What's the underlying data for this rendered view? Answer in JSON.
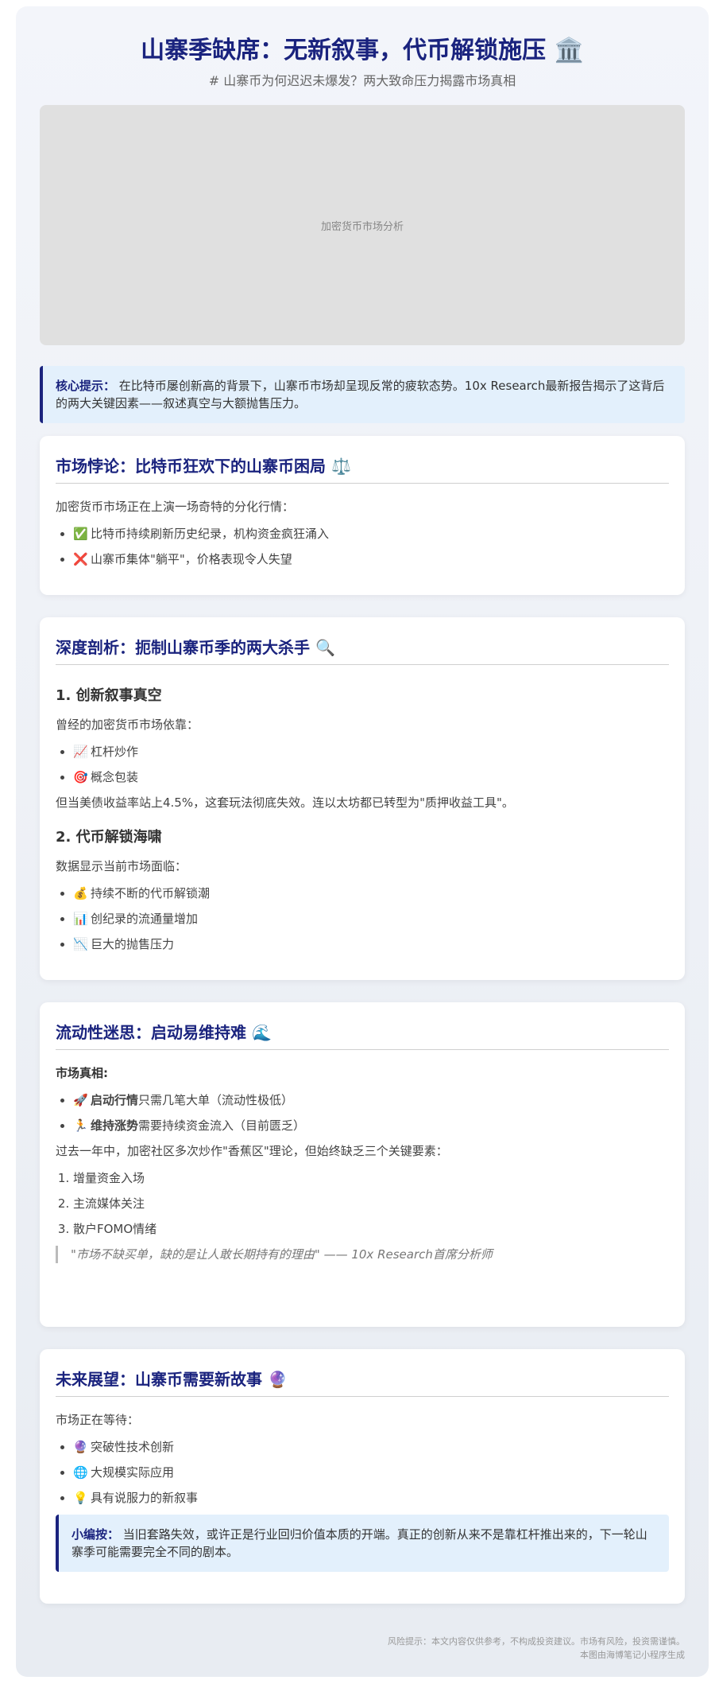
{
  "header": {
    "title": "山寨季缺席：无新叙事，代币解锁施压 🏛️",
    "subtitle": "# 山寨币为何迟迟未爆发？两大致命压力揭露市场真相"
  },
  "hero": {
    "caption": "加密货币市场分析"
  },
  "key_tip": {
    "label": "核心提示：",
    "text": "在比特币屡创新高的背景下，山寨币市场却呈现反常的疲软态势。10x Research最新报告揭示了这背后的两大关键因素——叙述真空与大额抛售压力。"
  },
  "section1": {
    "title": "市场悖论：比特币狂欢下的山寨币困局 ⚖️",
    "intro": "加密货币市场正在上演一场奇特的分化行情：",
    "items": [
      {
        "icon": "✅",
        "text": "比特币持续刷新历史纪录，机构资金疯狂涌入"
      },
      {
        "icon": "❌",
        "text": "山寨币集体\"躺平\"，价格表现令人失望"
      }
    ]
  },
  "section2": {
    "title": "深度剖析：扼制山寨币季的两大杀手 🔍",
    "sub1": {
      "heading": "1. 创新叙事真空",
      "intro": "曾经的加密货币市场依靠：",
      "items": [
        {
          "icon": "📈",
          "text": "杠杆炒作"
        },
        {
          "icon": "🎯",
          "text": "概念包装"
        }
      ],
      "outro": "但当美债收益率站上4.5%，这套玩法彻底失效。连以太坊都已转型为\"质押收益工具\"。"
    },
    "sub2": {
      "heading": "2. 代币解锁海啸",
      "intro": "数据显示当前市场面临：",
      "items": [
        {
          "icon": "💰",
          "text": "持续不断的代币解锁潮"
        },
        {
          "icon": "📊",
          "text": "创纪录的流通量增加"
        },
        {
          "icon": "📉",
          "text": "巨大的抛售压力"
        }
      ]
    }
  },
  "section3": {
    "title": "流动性迷思：启动易维持难 🌊",
    "truth_label": "市场真相:",
    "items": [
      {
        "icon": "🚀",
        "bold": "启动行情",
        "text": "只需几笔大单（流动性极低）"
      },
      {
        "icon": "🏃",
        "bold": "维持涨势",
        "text": "需要持续资金流入（目前匮乏）"
      }
    ],
    "para": "过去一年中，加密社区多次炒作\"香蕉区\"理论，但始终缺乏三个关键要素：",
    "ordered": [
      "增量资金入场",
      "主流媒体关注",
      "散户FOMO情绪"
    ],
    "quote": "\"市场不缺买单，缺的是让人敢长期持有的理由\" —— 10x Research首席分析师"
  },
  "section4": {
    "title": "未来展望：山寨币需要新故事 🔮",
    "intro": "市场正在等待：",
    "items": [
      {
        "icon": "🔮",
        "text": "突破性技术创新"
      },
      {
        "icon": "🌐",
        "text": "大规模实际应用"
      },
      {
        "icon": "💡",
        "text": "具有说服力的新叙事"
      }
    ],
    "note_label": "小编按：",
    "note_text": "当旧套路失效，或许正是行业回归价值本质的开端。真正的创新从来不是靠杠杆推出来的，下一轮山寨季可能需要完全不同的剧本。"
  },
  "footer": {
    "line1": "风险提示：本文内容仅供参考，不构成投资建议。市场有风险，投资需谨慎。",
    "line2": "本图由海博笔记小程序生成"
  }
}
